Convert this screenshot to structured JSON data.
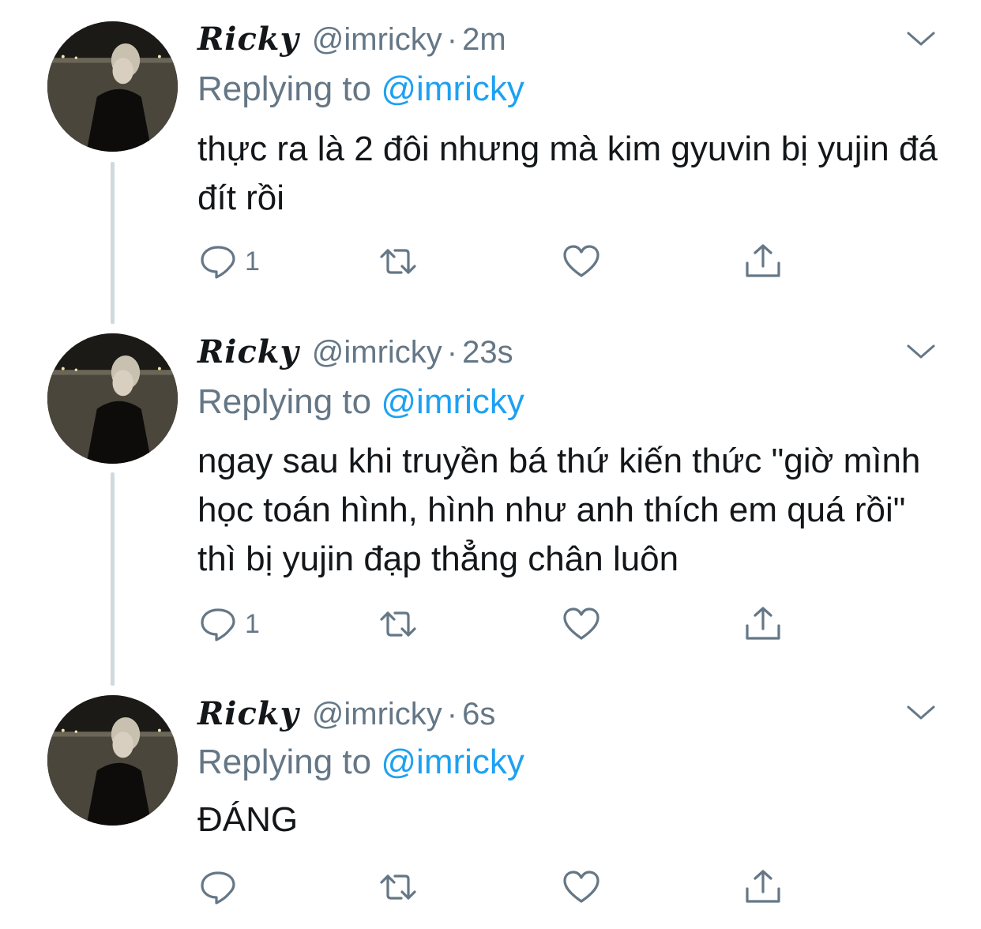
{
  "tweets": [
    {
      "display_name": "Ricky",
      "handle": "@imricky",
      "separator": "·",
      "time": "2m",
      "replying_prefix": "Replying to",
      "replying_handle": "@imricky",
      "text": "thực ra là 2 đôi nhưng mà kim gyuvin bị yujin đá đít rồi",
      "reply_count": "1"
    },
    {
      "display_name": "Ricky",
      "handle": "@imricky",
      "separator": "·",
      "time": "23s",
      "replying_prefix": "Replying to",
      "replying_handle": "@imricky",
      "text": "ngay sau khi truyền bá thứ kiến thức \"giờ mình học toán hình, hình như anh thích em quá rồi\" thì bị yujin đạp thẳng chân luôn",
      "reply_count": "1"
    },
    {
      "display_name": "Ricky",
      "handle": "@imricky",
      "separator": "·",
      "time": "6s",
      "replying_prefix": "Replying to",
      "replying_handle": "@imricky",
      "text": "ĐÁNG",
      "reply_count": ""
    }
  ],
  "icons": {
    "reply": "speech-bubble-icon",
    "retweet": "retweet-arrows-icon",
    "like": "heart-icon",
    "share": "share-upload-icon",
    "menu": "chevron-down-icon"
  },
  "colors": {
    "text": "#14171a",
    "secondary": "#657786",
    "link": "#1da1f2",
    "thread_line": "#cfd9de"
  }
}
